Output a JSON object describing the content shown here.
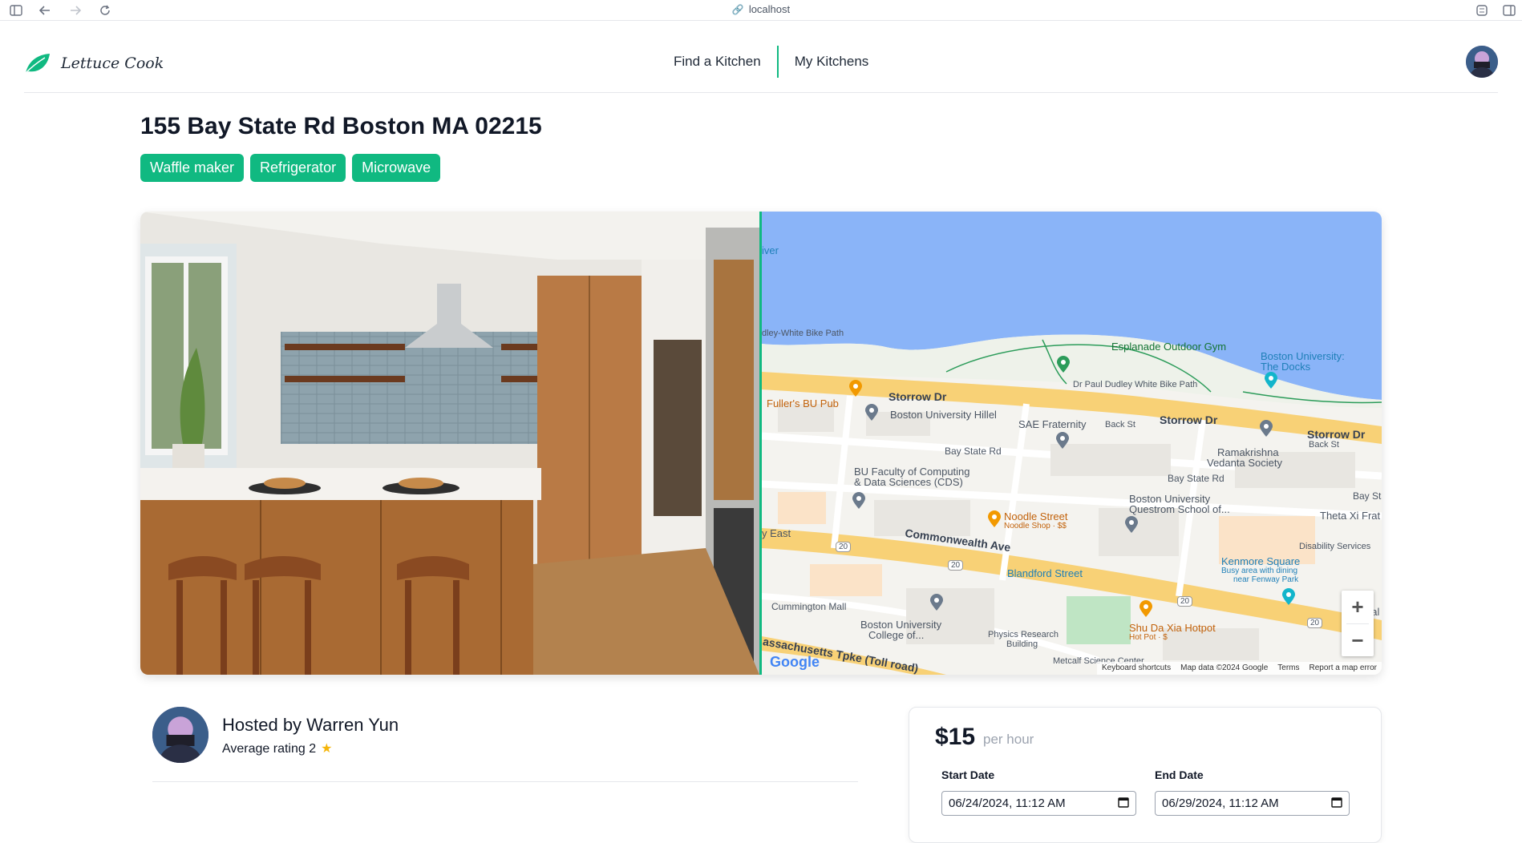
{
  "browser": {
    "url": "localhost"
  },
  "nav": {
    "brand": "Lettuce Cook",
    "links": [
      {
        "label": "Find a Kitchen"
      },
      {
        "label": "My Kitchens"
      }
    ]
  },
  "listing": {
    "address": "155 Bay State Rd Boston MA 02215",
    "amenities": [
      "Waffle maker",
      "Refrigerator",
      "Microwave"
    ]
  },
  "map": {
    "labels": {
      "river": "iver",
      "bike_path_1": "dley-White Bike Path",
      "bike_path_2": "Dr Paul Dudley White Bike Path",
      "esplanade": "Esplanade Outdoor Gym",
      "bu_docks_1": "Boston University:",
      "bu_docks_2": "The Docks",
      "fullers": "Fuller's BU Pub",
      "storrow_1": "Storrow Dr",
      "storrow_2": "Storrow Dr",
      "storrow_3": "Storrow Dr",
      "hillel": "Boston University Hillel",
      "sae": "SAE Fraternity",
      "back_st_1": "Back St",
      "back_st_2": "Back St",
      "bay_state_1": "Bay State Rd",
      "bay_state_2": "Bay State Rd",
      "bay_state_3": "Bay Sta",
      "ramakrishna_1": "Ramakrishna",
      "ramakrishna_2": "Vedanta Society",
      "cds_1": "BU Faculty of Computing",
      "cds_2": "& Data Sciences (CDS)",
      "noodle": "Noodle Street",
      "noodle_sub": "Noodle Shop · $$",
      "questrom_1": "Boston University",
      "questrom_2": "Questrom School of...",
      "theta": "Theta Xi Frat",
      "disability": "Disability Services",
      "east": "y East",
      "comm_ave": "Commonwealth Ave",
      "kenmore": "Kenmore Square",
      "kenmore_sub_1": "Busy area with dining",
      "kenmore_sub_2": "near Fenway Park",
      "blandford": "Blandford Street",
      "cummington": "Cummington Mall",
      "bu_college_1": "Boston University",
      "bu_college_2": "College of...",
      "physics_1": "Physics Research",
      "physics_2": "Building",
      "shu": "Shu Da Xia Hotpot",
      "shu_sub": "Hot Pot · $",
      "metcalf": "Metcalf Science Center",
      "mass_tpke": "assachusetts Tpke (Toll road)",
      "nal": "nal",
      "shield_1": "20",
      "shield_2": "20",
      "shield_3": "20",
      "shield_4": "20"
    },
    "zoom_in": "+",
    "zoom_out": "−",
    "google": "Google",
    "footer": [
      "Keyboard shortcuts",
      "Map data ©2024 Google",
      "Terms",
      "Report a map error"
    ]
  },
  "host": {
    "name": "Hosted by Warren Yun",
    "rating_label": "Average rating 2",
    "star": "★"
  },
  "booking": {
    "price": "$15",
    "unit": "per hour",
    "start_label": "Start Date",
    "start_value": "06/24/2024, 11:12 AM",
    "end_label": "End Date",
    "end_value": "06/29/2024, 11:12 AM"
  },
  "colors": {
    "accent": "#10b981",
    "water": "#8ab4f8",
    "road": "#f8d176"
  },
  "icons": {
    "calendar": "📅"
  }
}
